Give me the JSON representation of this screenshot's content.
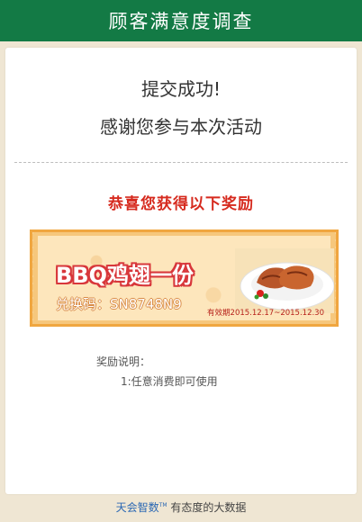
{
  "header": {
    "title": "顾客满意度调查"
  },
  "result": {
    "success": "提交成功!",
    "thanks": "感谢您参与本次活动"
  },
  "reward": {
    "congrats": "恭喜您获得以下奖励",
    "coupon": {
      "name": "BBQ鸡翅一份",
      "code_label": "兑换码：SN8748N9",
      "validity": "有效期2015.12.17~2015.12.30",
      "image": "grilled-chicken-wings-plate"
    }
  },
  "notes": {
    "title": "奖励说明：",
    "items": [
      "1:任意消费即可使用"
    ]
  },
  "footer": {
    "brand": "天会智数",
    "tm": "TM",
    "slogan": "有态度的大数据"
  },
  "colors": {
    "header_bg": "#137a45",
    "accent_red": "#d62a1e",
    "coupon_orange": "#f0a640",
    "brand_blue": "#2a67b3"
  }
}
